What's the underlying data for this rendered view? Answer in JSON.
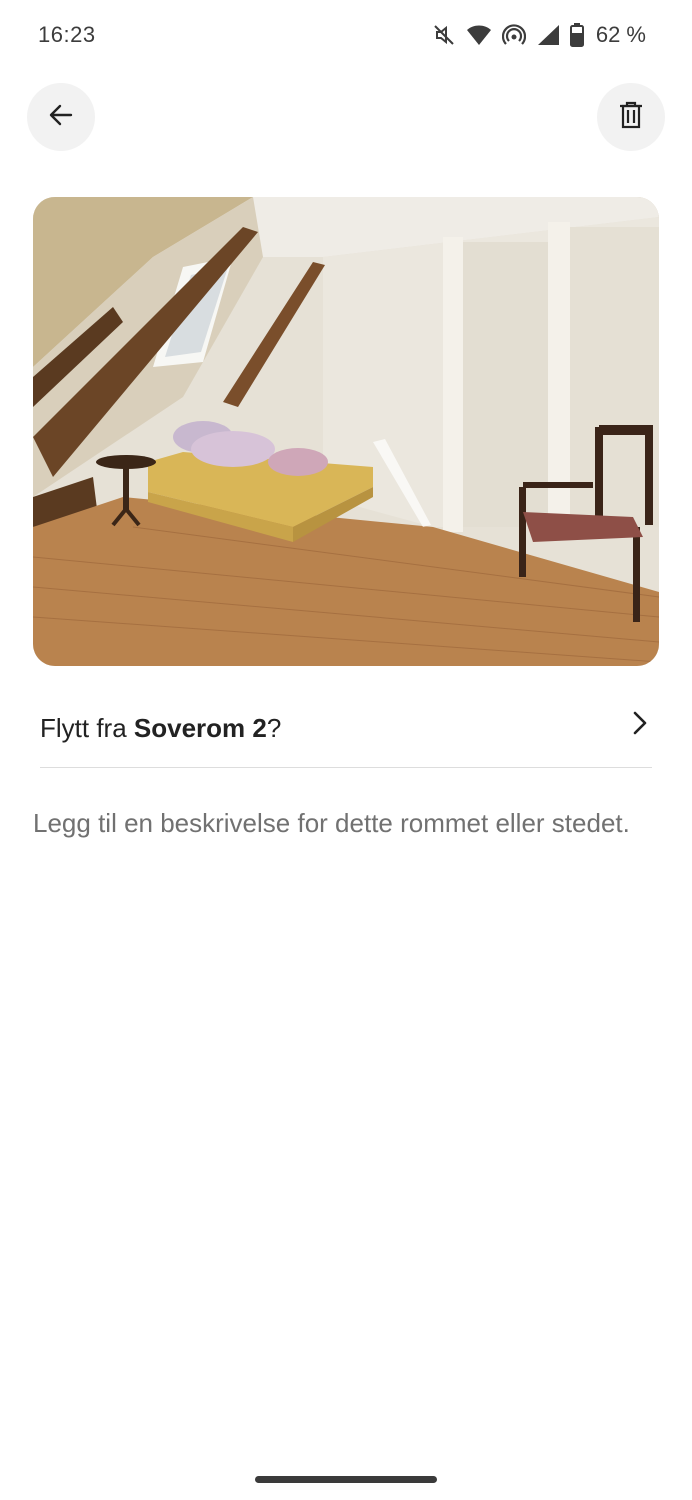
{
  "status_bar": {
    "time": "16:23",
    "icons": [
      "mute-icon",
      "wifi-icon",
      "hotspot-icon",
      "signal-icon",
      "battery-icon"
    ],
    "battery_percent": "62 %"
  },
  "toolbar": {
    "back_icon": "arrow-left-icon",
    "delete_icon": "trash-icon"
  },
  "photo": {
    "description_icon": "room-photo"
  },
  "move": {
    "prefix": "Flytt fra ",
    "room": "Soverom 2",
    "suffix": "?",
    "icon": "chevron-right-icon"
  },
  "description": {
    "placeholder": "Legg til en beskrivelse for dette rommet eller stedet."
  },
  "colors": {
    "text": "#222222",
    "muted": "#717171",
    "button_bg": "#f2f2f2",
    "divider": "#dddddd"
  }
}
